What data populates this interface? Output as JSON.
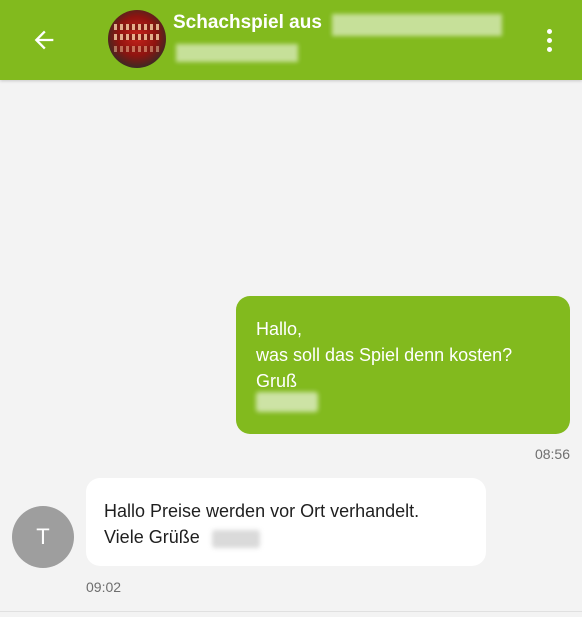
{
  "header": {
    "title": "Schachspiel aus",
    "back_icon": "arrow-left-icon",
    "menu_icon": "more-vertical-icon",
    "background_color": "#82ba1e"
  },
  "messages": [
    {
      "direction": "outgoing",
      "lines": [
        "Hallo,",
        "was soll das Spiel denn kosten?",
        "Gruß"
      ],
      "time": "08:56",
      "bubble_color": "#82ba1e"
    },
    {
      "direction": "incoming",
      "sender_initial": "T",
      "lines": [
        "Hallo Preise werden vor Ort verhandelt.",
        "Viele Grüße"
      ],
      "time": "09:02",
      "bubble_color": "#ffffff"
    }
  ]
}
